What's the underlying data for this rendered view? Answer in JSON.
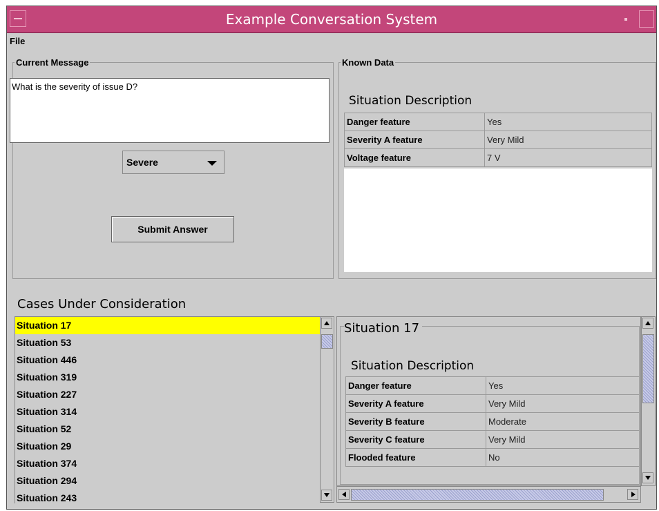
{
  "window": {
    "title": "Example Conversation System"
  },
  "menu": {
    "file": "File"
  },
  "current_message": {
    "legend": "Current Message",
    "text": "What is the severity of issue D?",
    "dropdown_value": "Severe",
    "submit_label": "Submit Answer"
  },
  "known_data": {
    "legend": "Known Data",
    "section_title": "Situation Description",
    "rows": [
      {
        "feature": "Danger feature",
        "value": "Yes"
      },
      {
        "feature": "Severity A feature",
        "value": "Very Mild"
      },
      {
        "feature": "Voltage feature",
        "value": "7 V"
      }
    ]
  },
  "cases": {
    "title": "Cases Under Consideration",
    "items": [
      "Situation 17",
      "Situation 53",
      "Situation 446",
      "Situation 319",
      "Situation 227",
      "Situation 314",
      "Situation 52",
      "Situation 29",
      "Situation 374",
      "Situation 294",
      "Situation 243"
    ],
    "selected_index": 0,
    "selected_color": "#ffff00"
  },
  "detail": {
    "legend": "Situation 17",
    "section_title": "Situation Description",
    "rows": [
      {
        "feature": "Danger feature",
        "value": "Yes"
      },
      {
        "feature": "Severity A feature",
        "value": "Very Mild"
      },
      {
        "feature": "Severity B feature",
        "value": "Moderate"
      },
      {
        "feature": "Severity C feature",
        "value": "Very Mild"
      },
      {
        "feature": "Flooded feature",
        "value": "No"
      }
    ]
  },
  "colors": {
    "titlebar": "#c3467a",
    "panel": "#cccccc"
  }
}
